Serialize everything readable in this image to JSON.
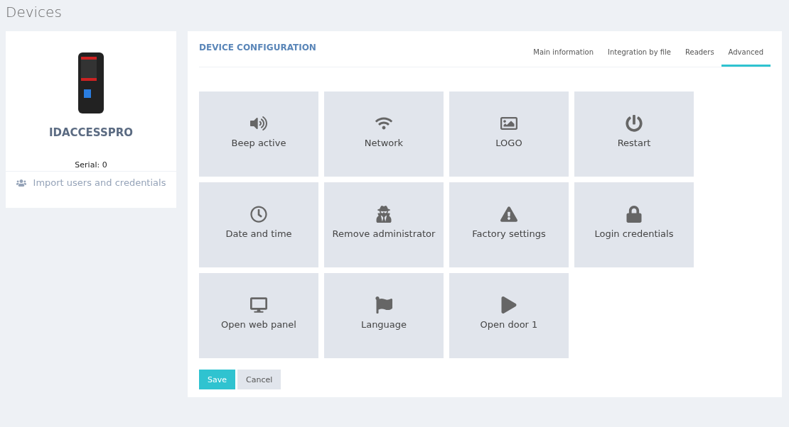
{
  "page": {
    "title": "Devices"
  },
  "device": {
    "name": "IDACCESSPRO",
    "serial": "Serial: 0",
    "import_link": "Import users and credentials"
  },
  "config": {
    "title": "DEVICE CONFIGURATION",
    "tabs": [
      {
        "label": "Main information",
        "selected": false
      },
      {
        "label": "Integration by file",
        "selected": false
      },
      {
        "label": "Readers",
        "selected": false
      },
      {
        "label": "Advanced",
        "selected": true
      }
    ],
    "tiles": [
      {
        "kind": "sound",
        "label": "Beep active"
      },
      {
        "kind": "wifi",
        "label": "Network"
      },
      {
        "kind": "image",
        "label": "LOGO"
      },
      {
        "kind": "power",
        "label": "Restart"
      },
      {
        "kind": "clock",
        "label": "Date and time"
      },
      {
        "kind": "spy",
        "label": "Remove administrator"
      },
      {
        "kind": "warning",
        "label": "Factory settings"
      },
      {
        "kind": "lock",
        "label": "Login credentials"
      },
      {
        "kind": "monitor",
        "label": "Open web panel"
      },
      {
        "kind": "flag",
        "label": "Language"
      },
      {
        "kind": "play",
        "label": "Open door 1"
      }
    ],
    "buttons": [
      {
        "kind": "primary",
        "label": "Save"
      },
      {
        "kind": "secondary",
        "label": "Cancel"
      }
    ]
  }
}
